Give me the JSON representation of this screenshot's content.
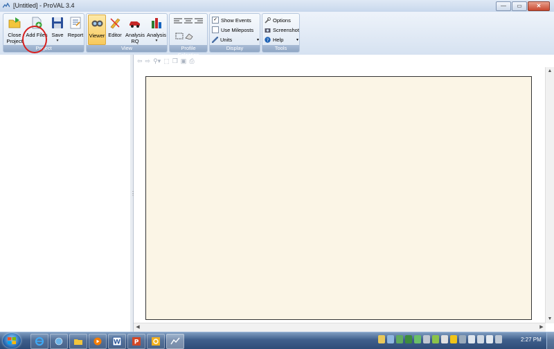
{
  "window": {
    "title": "[Untitled] - ProVAL 3.4",
    "controls": {
      "minimize": "—",
      "maximize": "▭",
      "close": "✕"
    }
  },
  "ribbon": {
    "groups": {
      "project": "Project",
      "view": "View",
      "profile_selection": "Profile Selection",
      "display": "Display",
      "tools": "Tools"
    },
    "project_buttons": {
      "close_project": "Close Project",
      "add_files": "Add Files",
      "save": "Save",
      "report": "Report"
    },
    "view_buttons": {
      "viewer": "Viewer",
      "editor": "Editor",
      "analysis_rq": "Analysis RQ",
      "analysis": "Analysis"
    },
    "display": {
      "show_events": "Show Events",
      "show_events_checked": true,
      "use_mileposts": "Use Mileposts",
      "use_mileposts_checked": false,
      "units": "Units"
    },
    "tools": {
      "options": "Options",
      "screenshot": "Screenshot",
      "help": "Help"
    },
    "dropdown_arrow": "▾"
  },
  "taskbar": {
    "clock": "2:27 PM"
  },
  "colors": {
    "plot_background": "#fbf5e6",
    "highlight_circle": "#d61e1e",
    "ribbon_active": "#f7c95c"
  }
}
